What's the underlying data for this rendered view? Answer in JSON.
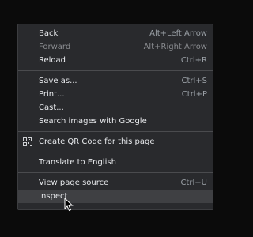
{
  "menu": {
    "items": [
      {
        "label": "Back",
        "shortcut": "Alt+Left Arrow"
      },
      {
        "label": "Forward",
        "shortcut": "Alt+Right Arrow"
      },
      {
        "label": "Reload",
        "shortcut": "Ctrl+R"
      },
      {
        "label": "Save as...",
        "shortcut": "Ctrl+S"
      },
      {
        "label": "Print...",
        "shortcut": "Ctrl+P"
      },
      {
        "label": "Cast..."
      },
      {
        "label": "Search images with Google"
      },
      {
        "label": "Create QR Code for this page",
        "icon": "qr-code-icon"
      },
      {
        "label": "Translate to English"
      },
      {
        "label": "View page source",
        "shortcut": "Ctrl+U"
      },
      {
        "label": "Inspect"
      }
    ],
    "disabled_item": "Forward",
    "selected_item": "Inspect"
  },
  "colors": {
    "background": "#0b0b0b",
    "menu_bg": "#292a2d",
    "text": "#e8eaed",
    "shortcut_text": "#9aa0a6",
    "disabled_text": "#8a8c90",
    "selected_bg": "#3f4043",
    "separator": "#4a4b4e"
  }
}
